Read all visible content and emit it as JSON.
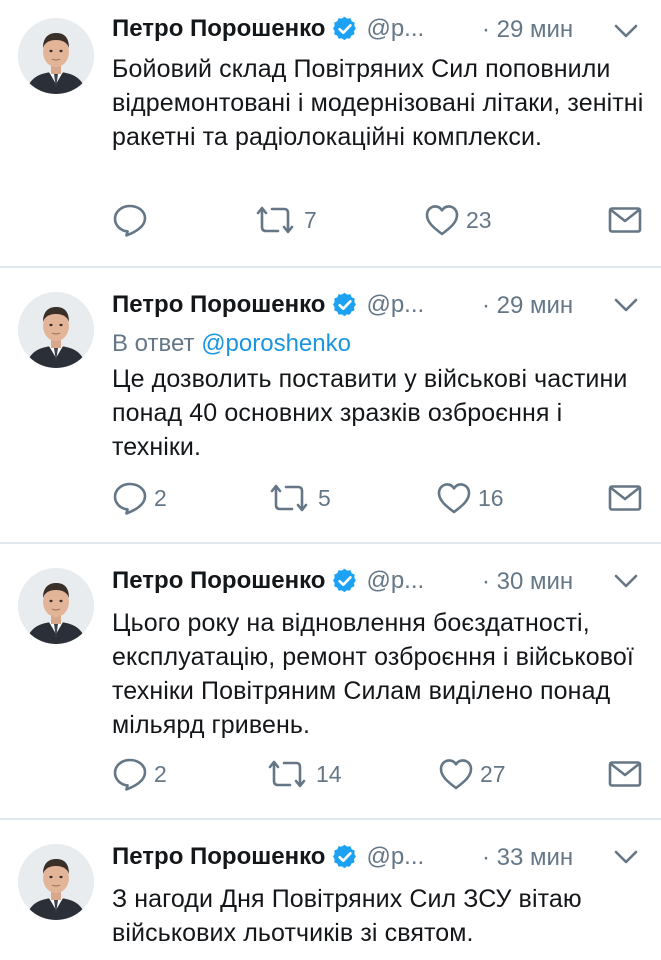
{
  "colors": {
    "text": "#14171a",
    "secondary": "#657786",
    "accent": "#1b95e0",
    "verified": "#1da1f2",
    "divider": "#e1e8ed"
  },
  "tweets": [
    {
      "name": "Петро Порошенко",
      "handle": "@p...",
      "time": "· 29 мин",
      "reply_prefix": "",
      "reply_mention": "",
      "text": "Бойовий склад Повітряних Сил поповнили відремонтовані і модернізовані літаки, зенітні ракетні та радіолокаційні комплекси.",
      "replies": "",
      "retweets": "7",
      "likes": "23"
    },
    {
      "name": "Петро Порошенко",
      "handle": "@p...",
      "time": "· 29 мин",
      "reply_prefix": "В ответ",
      "reply_mention": "@poroshenko",
      "text": "Це дозволить поставити у військові частини понад 40 основних зразків озброєння і техніки.",
      "replies": "2",
      "retweets": "5",
      "likes": "16"
    },
    {
      "name": "Петро Порошенко",
      "handle": "@p...",
      "time": "· 30 мин",
      "reply_prefix": "",
      "reply_mention": "",
      "text": "Цього року на відновлення боєздатності, експлуатацію, ремонт озброєння і військової техніки Повітряним Силам виділено понад мільярд гривень.",
      "replies": "2",
      "retweets": "14",
      "likes": "27"
    },
    {
      "name": "Петро Порошенко",
      "handle": "@p...",
      "time": "· 33 мин",
      "reply_prefix": "",
      "reply_mention": "",
      "text": "З нагоди Дня Повітряних Сил ЗСУ вітаю військових льотчиків зі святом.",
      "replies": "",
      "retweets": "",
      "likes": ""
    }
  ]
}
